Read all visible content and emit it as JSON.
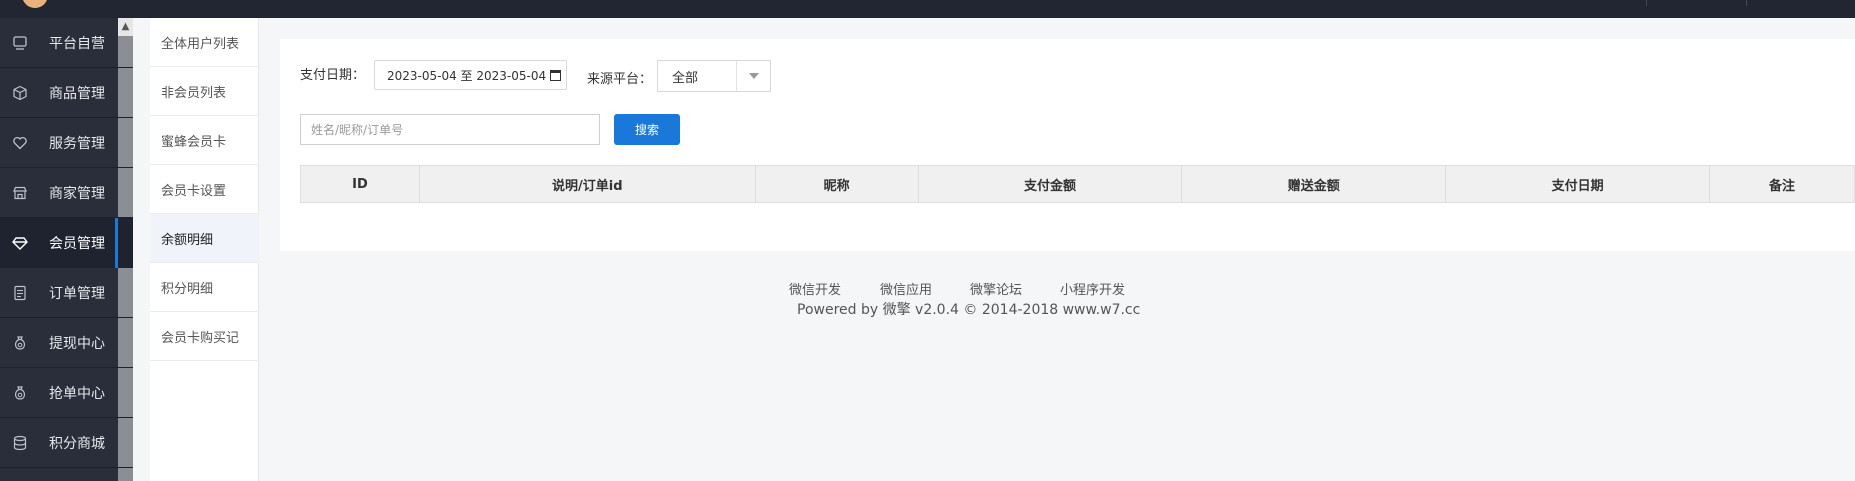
{
  "sidebar": {
    "items": [
      {
        "label": "平台自营",
        "icon": "monitor-icon"
      },
      {
        "label": "商品管理",
        "icon": "cube-icon"
      },
      {
        "label": "服务管理",
        "icon": "heart-icon"
      },
      {
        "label": "商家管理",
        "icon": "store-icon"
      },
      {
        "label": "会员管理",
        "icon": "diamond-icon"
      },
      {
        "label": "订单管理",
        "icon": "list-icon"
      },
      {
        "label": "提现中心",
        "icon": "money-bag-icon"
      },
      {
        "label": "抢单中心",
        "icon": "money-bag-icon"
      },
      {
        "label": "积分商城",
        "icon": "database-icon"
      }
    ],
    "active_index": 4
  },
  "subnav": {
    "items": [
      {
        "label": "全体用户列表"
      },
      {
        "label": "非会员列表"
      },
      {
        "label": "蜜蜂会员卡"
      },
      {
        "label": "会员卡设置"
      },
      {
        "label": "余额明细"
      },
      {
        "label": "积分明细"
      },
      {
        "label": "会员卡购买记"
      }
    ],
    "active_index": 4
  },
  "filters": {
    "pay_date_label": "支付日期：",
    "pay_date_value": "2023-05-04 至 2023-05-04",
    "source_label": "来源平台：",
    "source_value": "全部",
    "search_placeholder": "姓名/昵称/订单号",
    "search_button": "搜索"
  },
  "table": {
    "columns": [
      "ID",
      "说明/订单id",
      "昵称",
      "支付金额",
      "赠送金额",
      "支付日期",
      "备注"
    ]
  },
  "footer": {
    "links": [
      "微信开发",
      "微信应用",
      "微擎论坛",
      "小程序开发"
    ],
    "powered_by": "Powered by 微擎 v2.0.4 © 2014-2018 www.w7.cc"
  },
  "colors": {
    "topbar": "#222633",
    "sidebar": "#2a2e3b",
    "accent": "#1a79d8"
  }
}
